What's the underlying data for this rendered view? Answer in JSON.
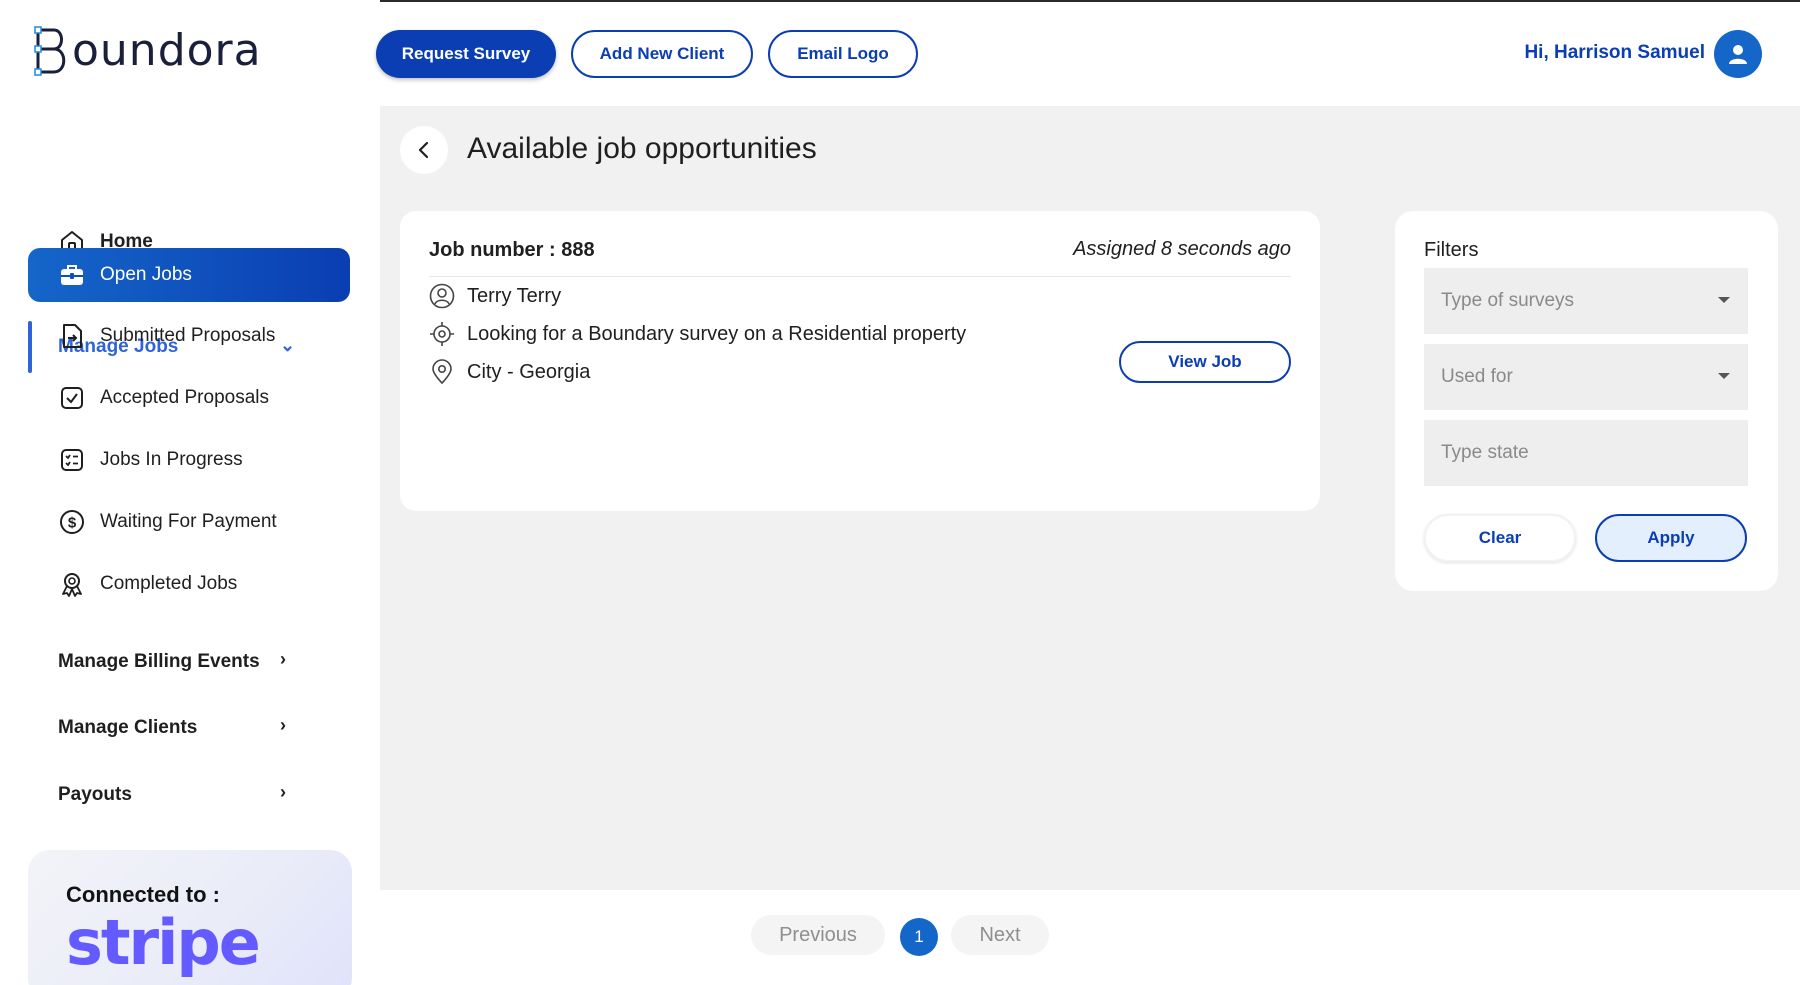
{
  "brand": {
    "logo_text": "oundora",
    "logo_initial": "B"
  },
  "topbar": {
    "request_survey": "Request Survey",
    "add_new_client": "Add New Client",
    "email_logo": "Email Logo",
    "greeting": "Hi, Harrison Samuel",
    "accent_color": "#0a3eb2"
  },
  "sidebar": {
    "home": "Home",
    "manage_jobs": "Manage Jobs",
    "items": [
      {
        "label": "Open Jobs",
        "icon": "briefcase-icon",
        "selected": true
      },
      {
        "label": "Submitted Proposals",
        "icon": "document-arrow-icon"
      },
      {
        "label": "Accepted Proposals",
        "icon": "checkbox-icon"
      },
      {
        "label": "Jobs In Progress",
        "icon": "checklist-icon"
      },
      {
        "label": "Waiting For Payment",
        "icon": "dollar-circle-icon"
      },
      {
        "label": "Completed Jobs",
        "icon": "award-icon"
      }
    ],
    "manage_billing_events": "Manage Billing Events",
    "manage_clients": "Manage Clients",
    "payouts": "Payouts",
    "connected_label": "Connected to :",
    "stripe": "stripe"
  },
  "main": {
    "title": "Available job opportunities",
    "job": {
      "number_label": "Job number : 888",
      "assigned": "Assigned 8 seconds ago",
      "client": "Terry Terry",
      "description": "Looking for a Boundary survey on a Residential property",
      "location": "City - Georgia",
      "view_job": "View Job"
    },
    "filters": {
      "title": "Filters",
      "type_of_surveys_placeholder": "Type of surveys",
      "used_for_placeholder": "Used for",
      "type_state_placeholder": "Type state",
      "clear": "Clear",
      "apply": "Apply"
    }
  },
  "pagination": {
    "previous": "Previous",
    "current": "1",
    "next": "Next"
  }
}
